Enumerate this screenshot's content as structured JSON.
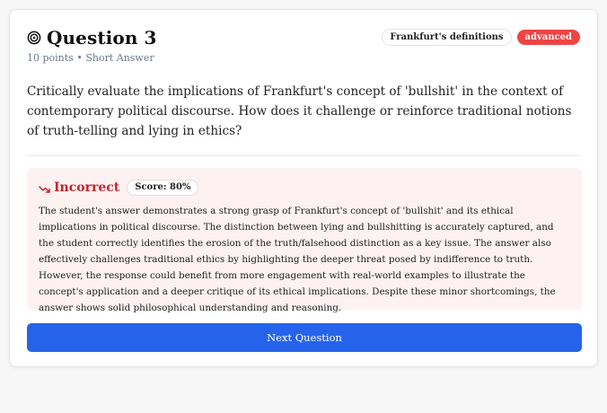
{
  "question": {
    "title": "Question 3",
    "points": "10 points",
    "separator": "•",
    "type": "Short Answer",
    "topic_badge": "Frankfurt's definitions",
    "level_badge": "advanced",
    "prompt": "Critically evaluate the implications of Frankfurt's concept of 'bullshit' in the context of contemporary political discourse. How does it challenge or reinforce traditional notions of truth-telling and lying in ethics?"
  },
  "feedback": {
    "status": "Incorrect",
    "score_label": "Score: 80%",
    "text": "The student's answer demonstrates a strong grasp of Frankfurt's concept of 'bullshit' and its ethical implications in political discourse. The distinction between lying and bullshitting is accurately captured, and the student correctly identifies the erosion of the truth/falsehood distinction as a key issue. The answer also effectively challenges traditional ethics by highlighting the deeper threat posed by indifference to truth. However, the response could benefit from more engagement with real-world examples to illustrate the concept's application and a deeper critique of its ethical implications. Despite these minor shortcomings, the answer shows solid philosophical understanding and reasoning."
  },
  "actions": {
    "next_label": "Next Question"
  },
  "icons": {
    "title_icon": "target-icon",
    "status_icon": "trending-down-icon"
  },
  "colors": {
    "accent_blue": "#2563eb",
    "badge_red": "#ef4444",
    "incorrect_red": "#c0262d",
    "feedback_bg": "#fdf1f1"
  }
}
